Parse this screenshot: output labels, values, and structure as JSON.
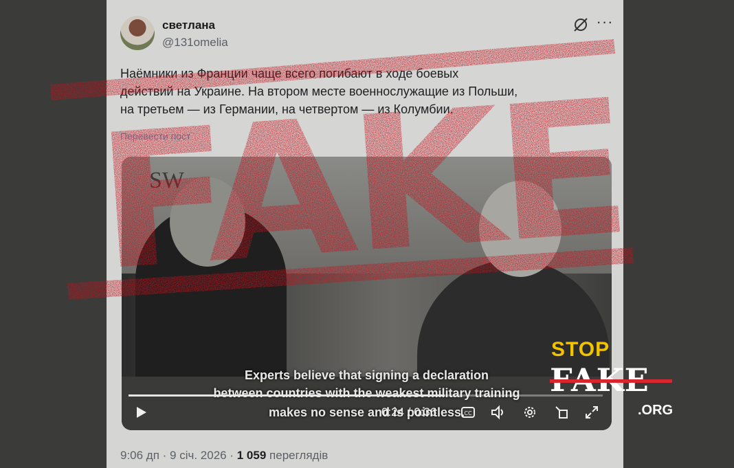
{
  "tweet": {
    "author_name": "светлана",
    "author_handle": "@131omelia",
    "text_lines": [
      "Наёмники из Франции чаще всего погибают в ходе боевых",
      "действий на Украине. На втором месте военнослужащие из Польши,",
      "на третьем — из Германии, на четвертом — из Колумбии."
    ],
    "translate_label": "Перевести пост",
    "timestamp": "9:06 дп · 9 січ. 2026 ·",
    "views_count": "1 059",
    "views_label": "переглядів"
  },
  "video": {
    "watermark": "SW",
    "subtitles": [
      "Experts believe that signing a declaration",
      "between countries with the weakest military training",
      "makes no sense and is pointless."
    ],
    "time_display": "0:24 / 0:36",
    "progress": 0.667,
    "icons": [
      "play-icon",
      "captions-icon",
      "volume-icon",
      "settings-icon",
      "minimize-icon",
      "fullscreen-icon"
    ]
  },
  "overlay": {
    "stamp_text": "FAKE",
    "stamp_color": "#c4111b"
  },
  "logo": {
    "stop": "STOP",
    "fake": "FAKE",
    "org": ".ORG",
    "colors": {
      "stop": "#f2c300",
      "strike": "#d8262e"
    }
  }
}
